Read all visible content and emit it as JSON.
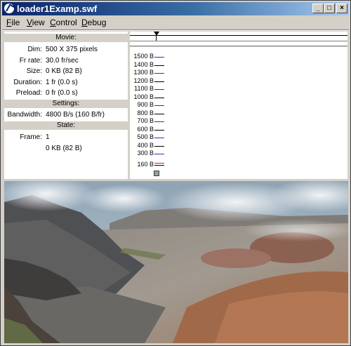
{
  "window": {
    "title": "loader1Examp.swf",
    "buttons": {
      "minimize": "_",
      "maximize": "□",
      "close": "×"
    }
  },
  "menu": [
    {
      "label": "File",
      "accel": "F",
      "rest": "ile"
    },
    {
      "label": "View",
      "accel": "V",
      "rest": "iew"
    },
    {
      "label": "Control",
      "accel": "C",
      "rest": "ontrol"
    },
    {
      "label": "Debug",
      "accel": "D",
      "rest": "ebug"
    }
  ],
  "info": {
    "movie_header": "Movie:",
    "dim_label": "Dim:",
    "dim_value": "500 X 375 pixels",
    "fr_label": "Fr rate:",
    "fr_value": "30.0 fr/sec",
    "size_label": "Size:",
    "size_value": "0 KB (82 B)",
    "duration_label": "Duration:",
    "duration_value": "1 fr (0.0 s)",
    "preload_label": "Preload:",
    "preload_value": "0 fr (0.0 s)",
    "settings_header": "Settings:",
    "bandwidth_label": "Bandwidth:",
    "bandwidth_value": "4800 B/s (160 B/fr)",
    "state_header": "State:",
    "frame_label": "Frame:",
    "frame_value": "1",
    "state_size_value": "0 KB (82 B)"
  },
  "graph": {
    "labels": [
      "1500 B",
      "1400 B",
      "1300 B",
      "1200 B",
      "1100 B",
      "1000 B",
      "900 B",
      "800 B",
      "700 B",
      "600 B",
      "500 B",
      "400 B",
      "300 B",
      "160 B"
    ],
    "colors": {
      "blue": "#2233cc",
      "black": "#000000",
      "red": "#cc2222"
    }
  },
  "icons": {
    "app": "flash-player-icon",
    "playhead": "playhead-icon"
  }
}
